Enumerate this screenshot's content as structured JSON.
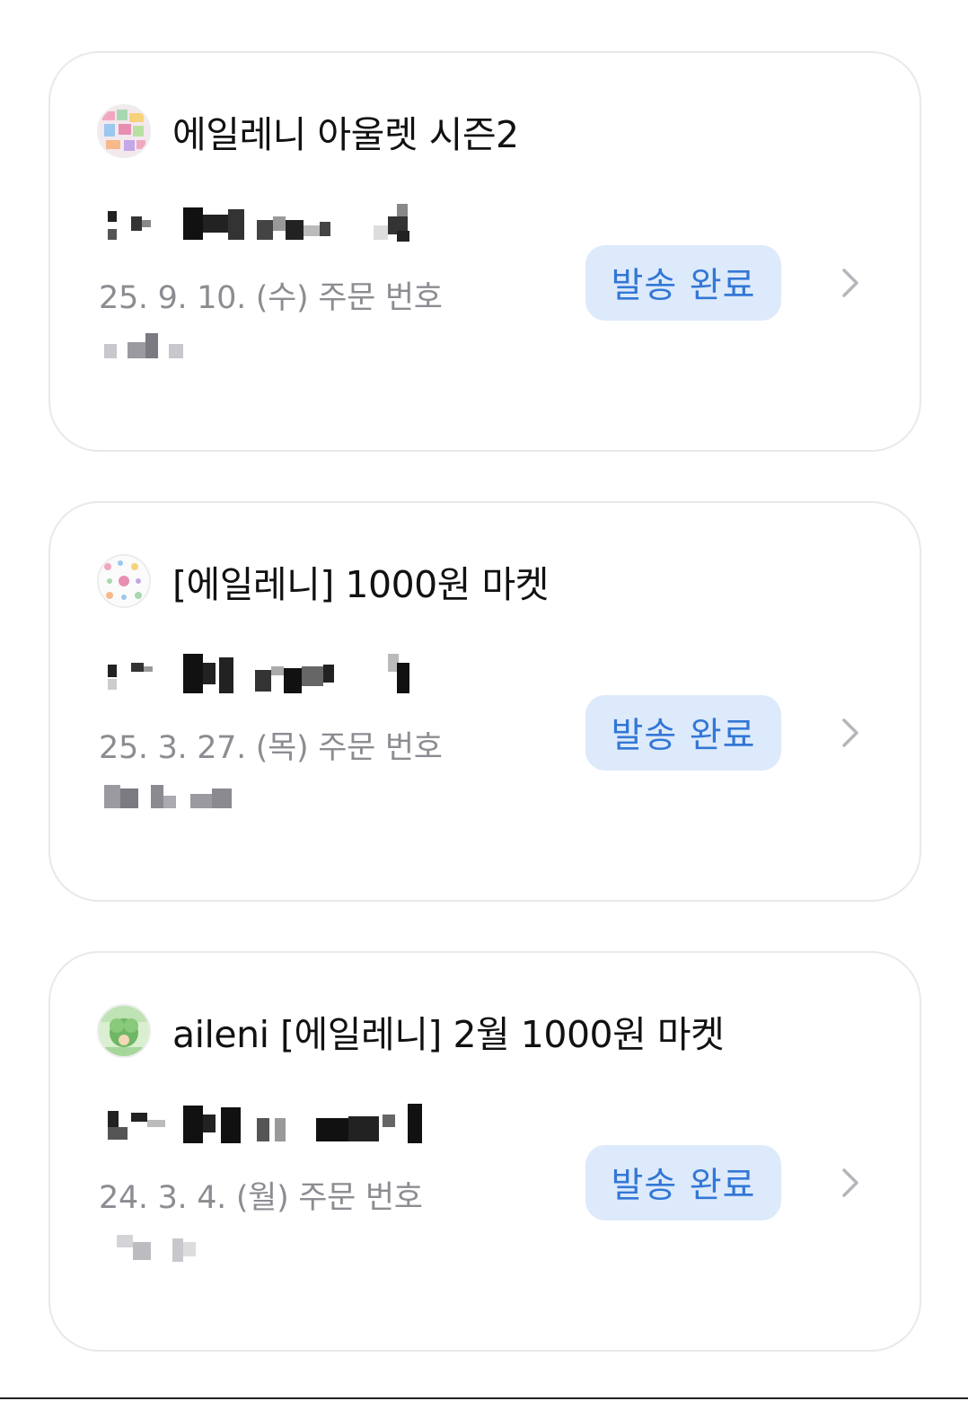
{
  "orders": [
    {
      "store_name": "에일레니 아울렛 시즌2",
      "date_label": "25. 9. 10. (수) 주문 번호",
      "status": "발송 완료",
      "avatar_icon": "sticker-collage-avatar-icon",
      "status_color": "#3377d6",
      "badge_bg": "#ddeafb"
    },
    {
      "store_name": "[에일레니] 1000원 마켓",
      "date_label": "25. 3. 27. (목) 주문 번호",
      "status": "발송 완료",
      "avatar_icon": "pattern-sticker-avatar-icon",
      "status_color": "#3377d6",
      "badge_bg": "#ddeafb"
    },
    {
      "store_name": "aileni [에일레니] 2월 1000원 마켓",
      "date_label": "24. 3. 4. (월) 주문 번호",
      "status": "발송 완료",
      "avatar_icon": "green-character-avatar-icon",
      "status_color": "#3377d6",
      "badge_bg": "#ddeafb"
    }
  ],
  "icons": {
    "chevron": "chevron-right-icon"
  }
}
